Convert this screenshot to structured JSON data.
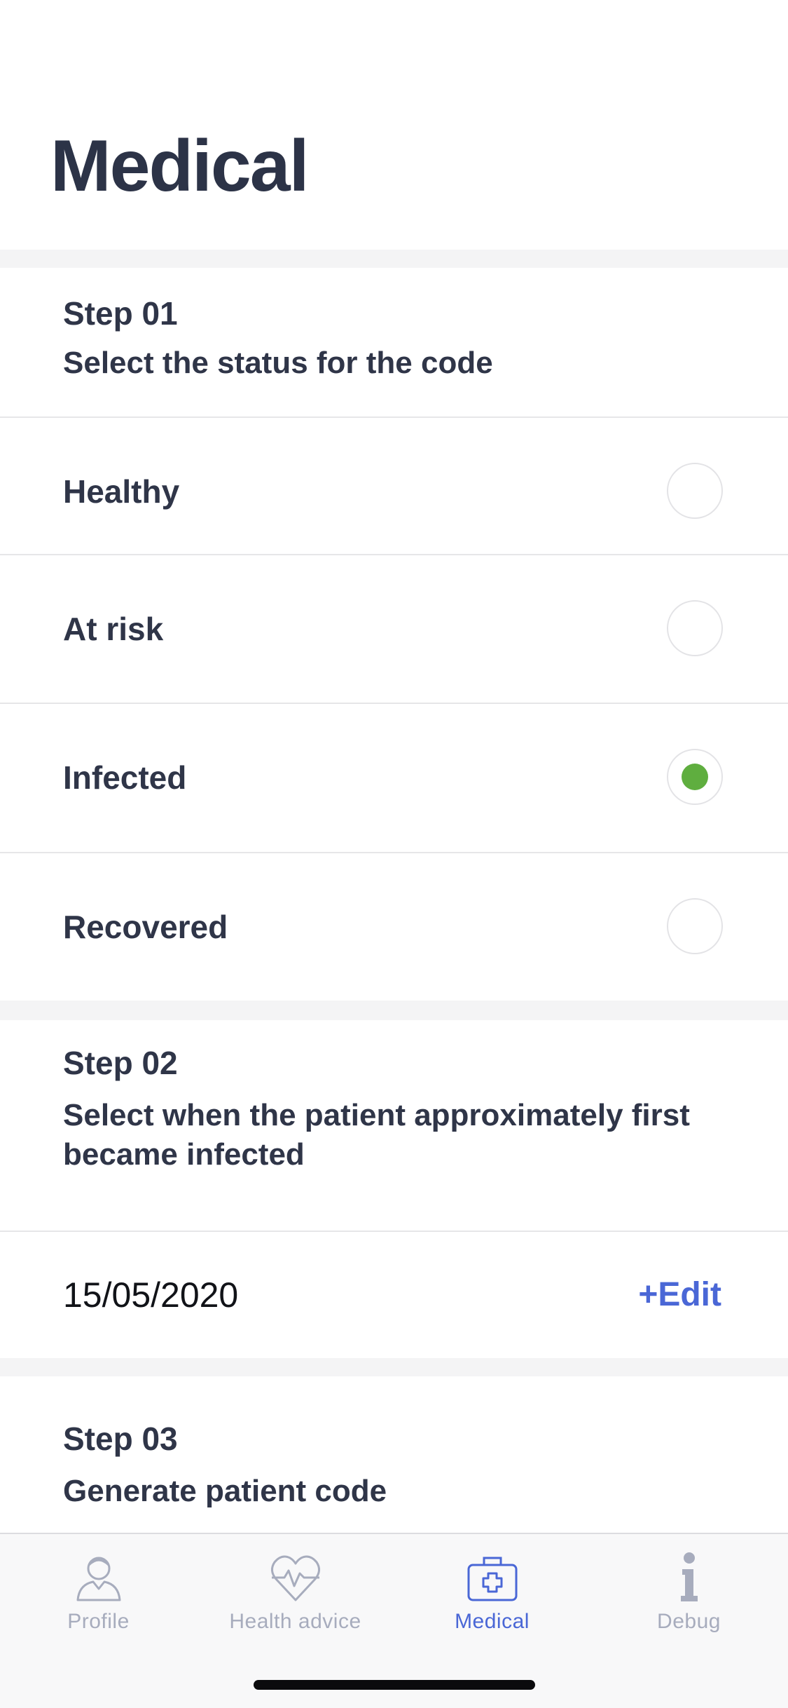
{
  "header": {
    "title": "Medical"
  },
  "step1": {
    "label": "Step 01",
    "description": "Select the status for the code",
    "options": [
      {
        "label": "Healthy",
        "selected": false
      },
      {
        "label": "At risk",
        "selected": false
      },
      {
        "label": "Infected",
        "selected": true
      },
      {
        "label": "Recovered",
        "selected": false
      }
    ]
  },
  "step2": {
    "label": "Step 02",
    "description": "Select when the patient approximately first became infected",
    "date": "15/05/2020",
    "edit_label": "+Edit"
  },
  "step3": {
    "label": "Step 03",
    "description": "Generate patient code"
  },
  "tabbar": {
    "tabs": [
      {
        "label": "Profile",
        "icon": "person-icon",
        "active": false
      },
      {
        "label": "Health advice",
        "icon": "heart-pulse-icon",
        "active": false
      },
      {
        "label": "Medical",
        "icon": "medical-kit-icon",
        "active": true
      },
      {
        "label": "Debug",
        "icon": "info-icon",
        "active": false
      }
    ]
  },
  "colors": {
    "accent": "#4a67d6",
    "selected_radio": "#5fae3f",
    "text_primary": "#2f3548",
    "tab_inactive": "#a7acbd",
    "section_gap": "#f4f4f5"
  }
}
